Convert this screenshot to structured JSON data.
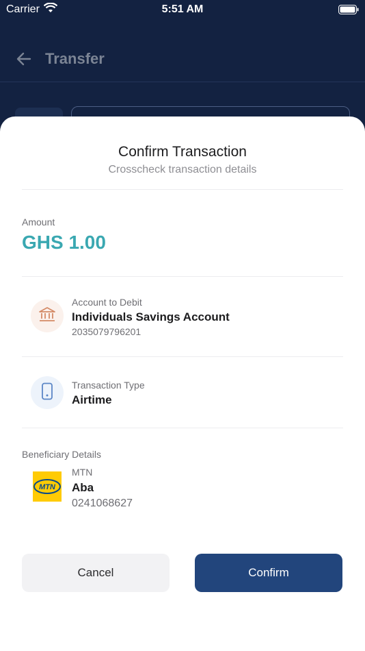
{
  "status_bar": {
    "carrier": "Carrier",
    "time": "5:51 AM"
  },
  "header": {
    "title": "Transfer"
  },
  "sheet": {
    "title": "Confirm Transaction",
    "subtitle": "Crosscheck transaction details",
    "amount": {
      "label": "Amount",
      "value": "GHS 1.00"
    },
    "account": {
      "label": "Account to Debit",
      "name": "Individuals Savings Account",
      "number": "2035079796201",
      "icon": "bank-icon"
    },
    "transaction_type": {
      "label": "Transaction Type",
      "value": "Airtime",
      "icon": "phone-icon"
    },
    "beneficiary": {
      "section_label": "Beneficiary Details",
      "network": "MTN",
      "name": "Aba",
      "phone": "0241068627",
      "logo_text": "MTN"
    },
    "buttons": {
      "cancel": "Cancel",
      "confirm": "Confirm"
    }
  },
  "colors": {
    "header_bg": "#132241",
    "amount": "#3aa8b1",
    "confirm_bg": "#22457c",
    "mtn_yellow": "#ffcb05"
  }
}
